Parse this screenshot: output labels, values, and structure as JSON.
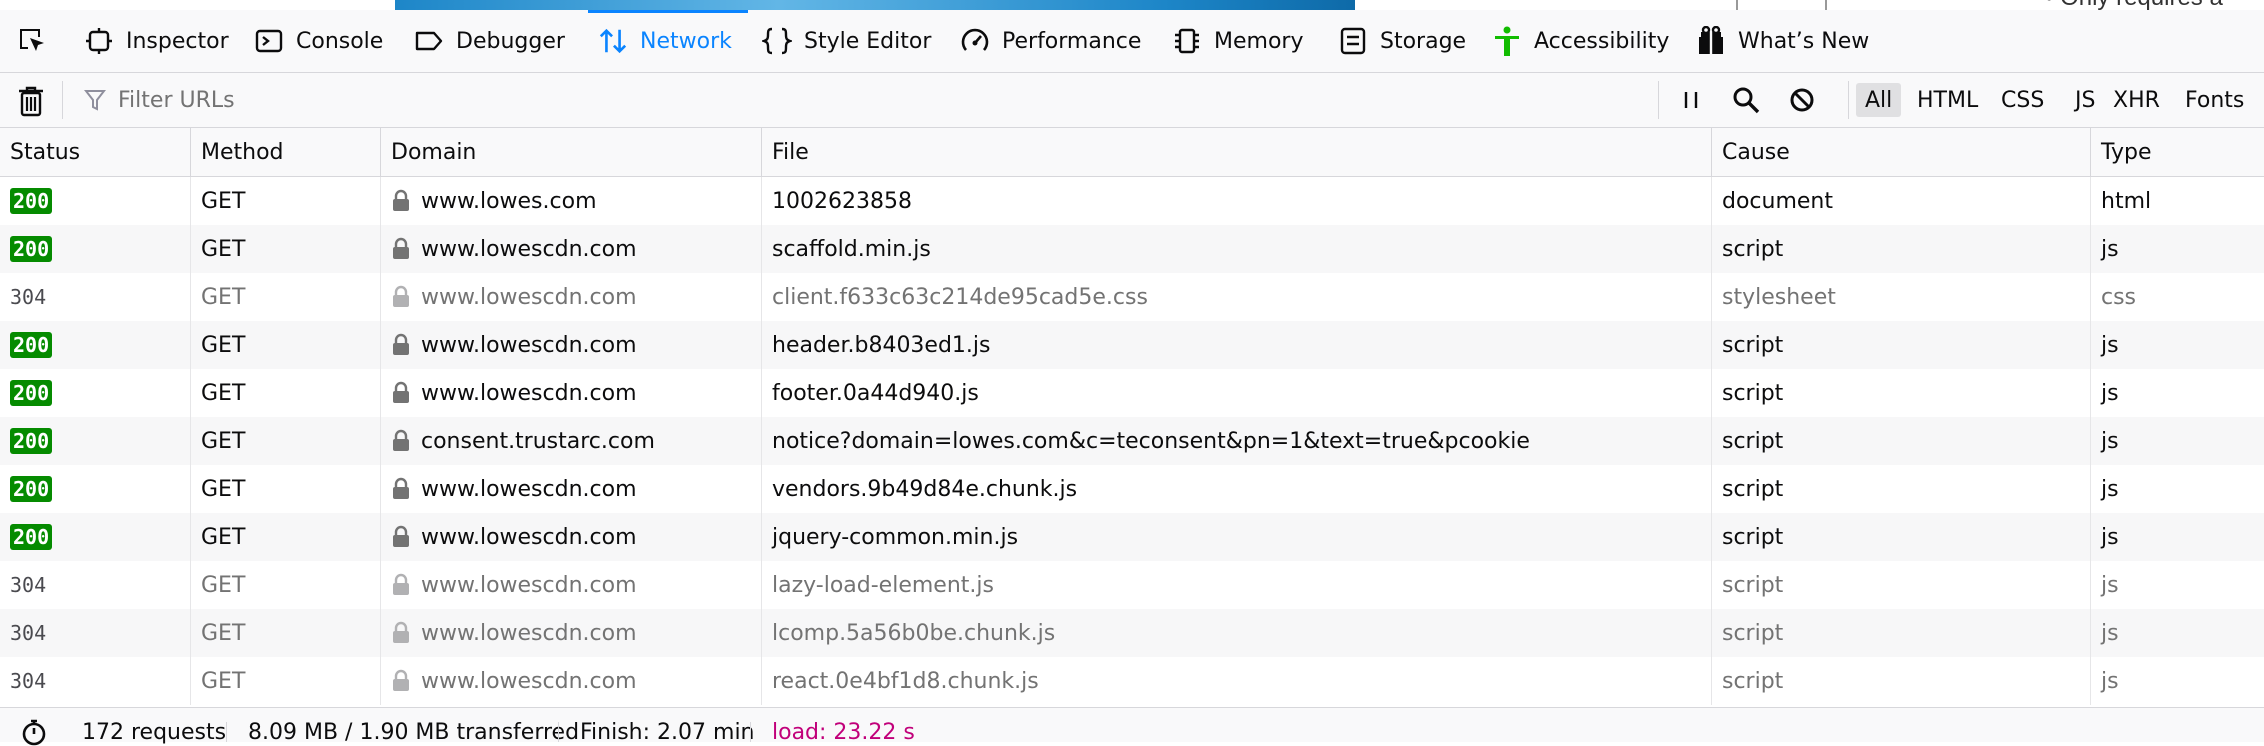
{
  "page_fragment": "• Only requires a",
  "tabs": [
    {
      "label": "Inspector",
      "icon": "inspector-icon"
    },
    {
      "label": "Console",
      "icon": "console-icon"
    },
    {
      "label": "Debugger",
      "icon": "debugger-icon"
    },
    {
      "label": "Network",
      "icon": "network-icon",
      "selected": true
    },
    {
      "label": "Style Editor",
      "icon": "style-editor-icon"
    },
    {
      "label": "Performance",
      "icon": "performance-icon"
    },
    {
      "label": "Memory",
      "icon": "memory-icon"
    },
    {
      "label": "Storage",
      "icon": "storage-icon"
    },
    {
      "label": "Accessibility",
      "icon": "accessibility-icon"
    },
    {
      "label": "What’s New",
      "icon": "whats-new-icon"
    }
  ],
  "toolbar": {
    "filter_placeholder": "Filter URLs",
    "filter_types": [
      "All",
      "HTML",
      "CSS",
      "JS",
      "XHR",
      "Fonts"
    ],
    "active_filter": "All"
  },
  "columns": [
    "Status",
    "Method",
    "Domain",
    "File",
    "Cause",
    "Type"
  ],
  "rows": [
    {
      "status": "200",
      "method": "GET",
      "domain": "www.lowes.com",
      "file": "1002623858",
      "cause": "document",
      "type": "html"
    },
    {
      "status": "200",
      "method": "GET",
      "domain": "www.lowescdn.com",
      "file": "scaffold.min.js",
      "cause": "script",
      "type": "js"
    },
    {
      "status": "304",
      "method": "GET",
      "domain": "www.lowescdn.com",
      "file": "client.f633c63c214de95cad5e.css",
      "cause": "stylesheet",
      "type": "css"
    },
    {
      "status": "200",
      "method": "GET",
      "domain": "www.lowescdn.com",
      "file": "header.b8403ed1.js",
      "cause": "script",
      "type": "js"
    },
    {
      "status": "200",
      "method": "GET",
      "domain": "www.lowescdn.com",
      "file": "footer.0a44d940.js",
      "cause": "script",
      "type": "js"
    },
    {
      "status": "200",
      "method": "GET",
      "domain": "consent.trustarc.com",
      "file": "notice?domain=lowes.com&c=teconsent&pn=1&text=true&pcookie",
      "cause": "script",
      "type": "js"
    },
    {
      "status": "200",
      "method": "GET",
      "domain": "www.lowescdn.com",
      "file": "vendors.9b49d84e.chunk.js",
      "cause": "script",
      "type": "js"
    },
    {
      "status": "200",
      "method": "GET",
      "domain": "www.lowescdn.com",
      "file": "jquery-common.min.js",
      "cause": "script",
      "type": "js"
    },
    {
      "status": "304",
      "method": "GET",
      "domain": "www.lowescdn.com",
      "file": "lazy-load-element.js",
      "cause": "script",
      "type": "js"
    },
    {
      "status": "304",
      "method": "GET",
      "domain": "www.lowescdn.com",
      "file": "lcomp.5a56b0be.chunk.js",
      "cause": "script",
      "type": "js"
    },
    {
      "status": "304",
      "method": "GET",
      "domain": "www.lowescdn.com",
      "file": "react.0e4bf1d8.chunk.js",
      "cause": "script",
      "type": "js"
    }
  ],
  "footer": {
    "requests": "172 requests",
    "transferred": "8.09 MB / 1.90 MB transferred",
    "finish": "Finish: 2.07 min",
    "load": "load: 23.22 s"
  },
  "colors": {
    "accent": "#0a84ff",
    "status_ok_bg": "#058b00",
    "load_text": "#c1007a",
    "accessibility_icon": "#12bc00"
  }
}
